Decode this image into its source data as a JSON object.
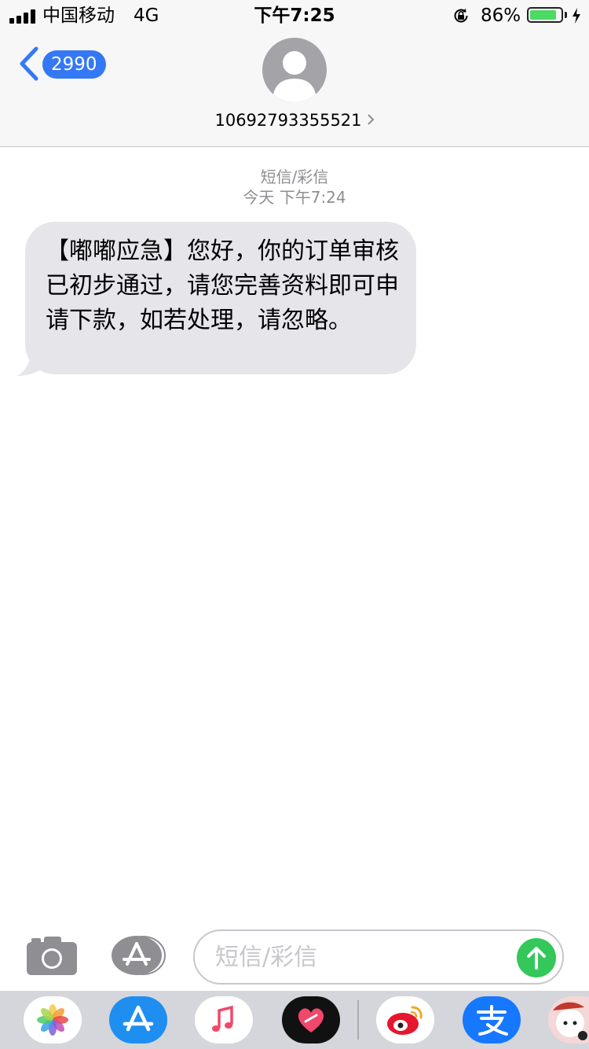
{
  "status_bar": {
    "carrier": "中国移动",
    "network": "4G",
    "time": "下午7:25",
    "battery_percent": "86%",
    "battery_level": 0.86,
    "icons": [
      "signal-bars-icon",
      "rotation-lock-icon",
      "battery-icon",
      "charging-bolt-icon"
    ]
  },
  "nav": {
    "back_count": "2990",
    "contact_number": "10692793355521"
  },
  "thread": {
    "message_type": "短信/彩信",
    "timestamp": "今天 下午7:24",
    "messages": [
      {
        "direction": "incoming",
        "text": "【嘟嘟应急】您好，你的订单审核已初步通过，请您完善资料即可申请下款，如若处理，请忽略。"
      }
    ]
  },
  "input_bar": {
    "placeholder": "短信/彩信"
  },
  "app_drawer": {
    "apps": [
      "photos-icon",
      "app-store-icon",
      "music-icon",
      "digital-touch-icon",
      "weibo-icon",
      "alipay-icon",
      "sticker-icon"
    ]
  },
  "colors": {
    "ios_blue": "#3478f6",
    "bubble_gray": "#e5e5ea",
    "send_green": "#34c759",
    "battery_green": "#4cd964"
  }
}
